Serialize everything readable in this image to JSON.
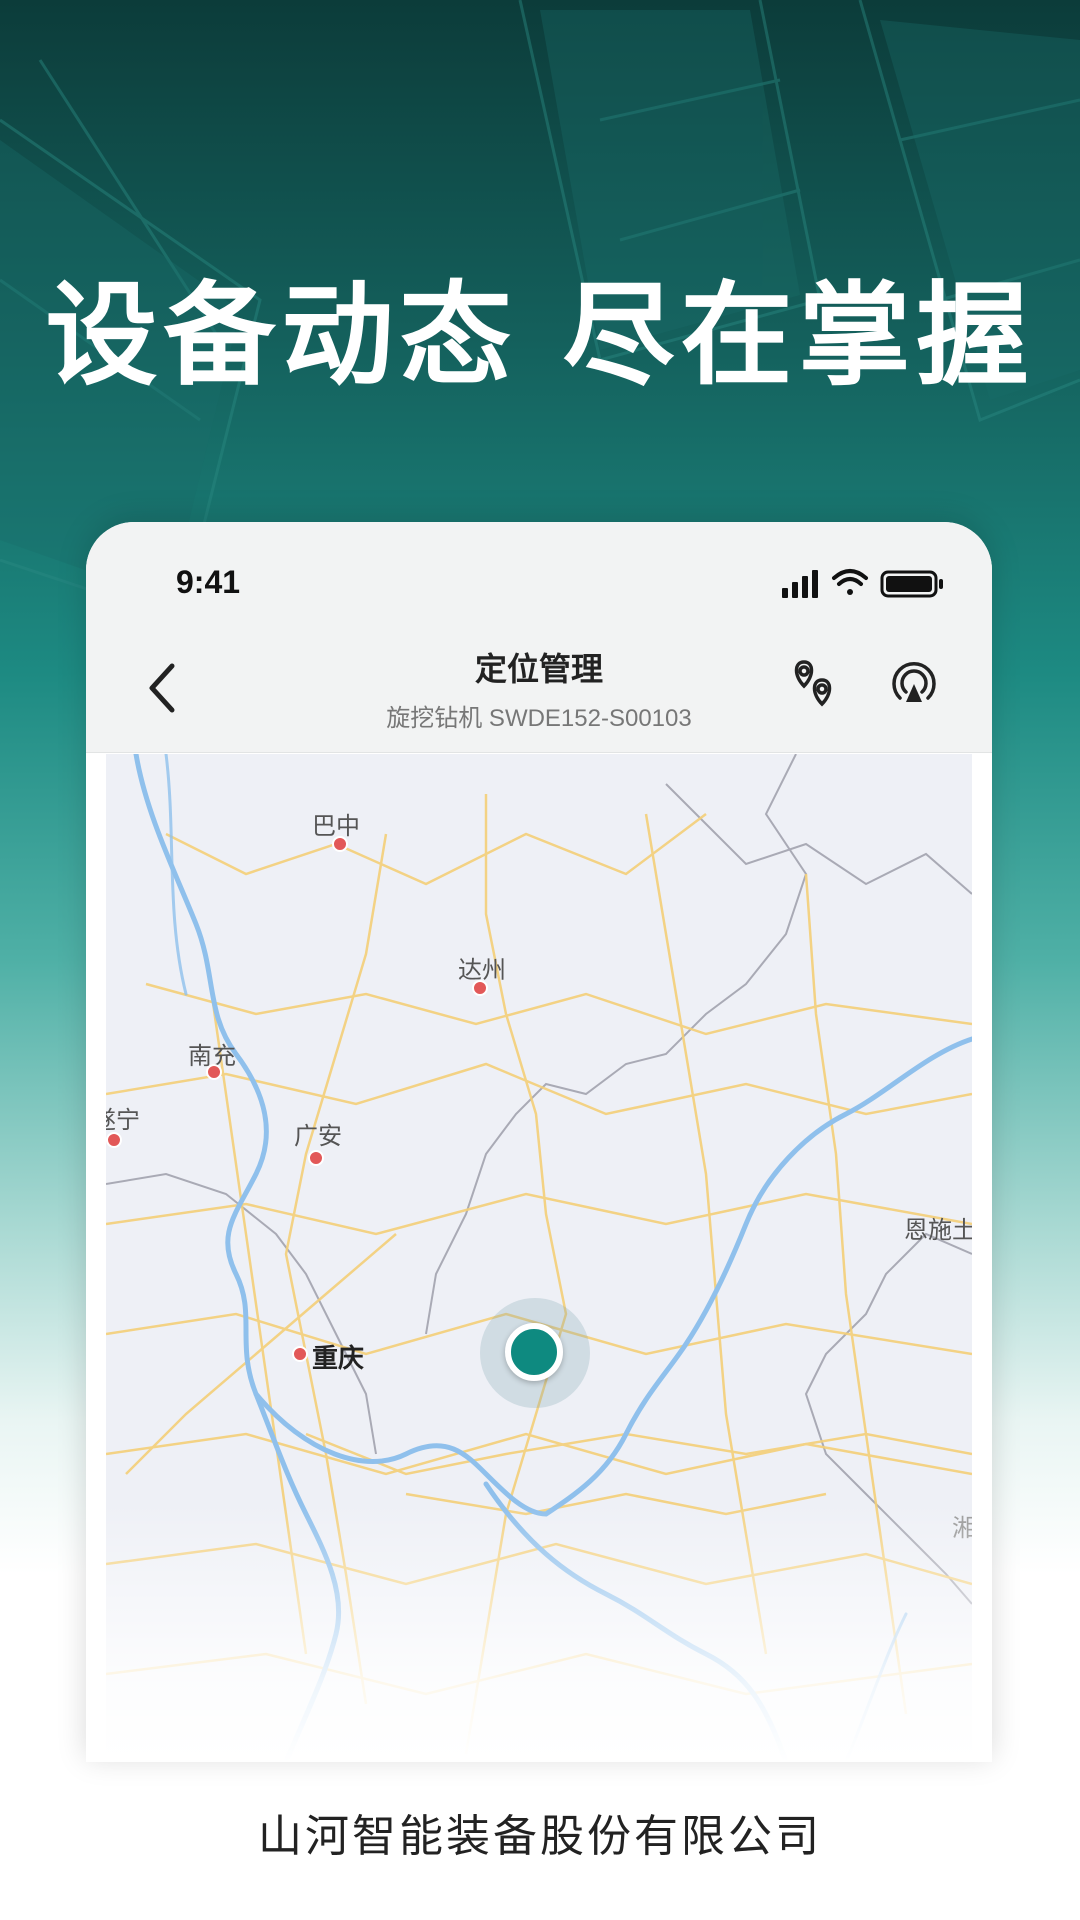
{
  "headline": "设备动态 尽在掌握",
  "status_bar": {
    "time": "9:41"
  },
  "nav": {
    "title": "定位管理",
    "subtitle": "旋挖钻机 SWDE152-S00103"
  },
  "map": {
    "cities": {
      "bazhong": "巴中",
      "dazhou": "达州",
      "nanchong": "南充",
      "suining": "遂宁",
      "guangan": "广安",
      "chongqing": "重庆",
      "enshi": "恩施土",
      "hu": "湘"
    }
  },
  "footer": "山河智能装备股份有限公司",
  "colors": {
    "accent": "#0e8a80",
    "city_dot": "#e25858",
    "river": "#8fc0ec",
    "road": "#f4cf78"
  }
}
